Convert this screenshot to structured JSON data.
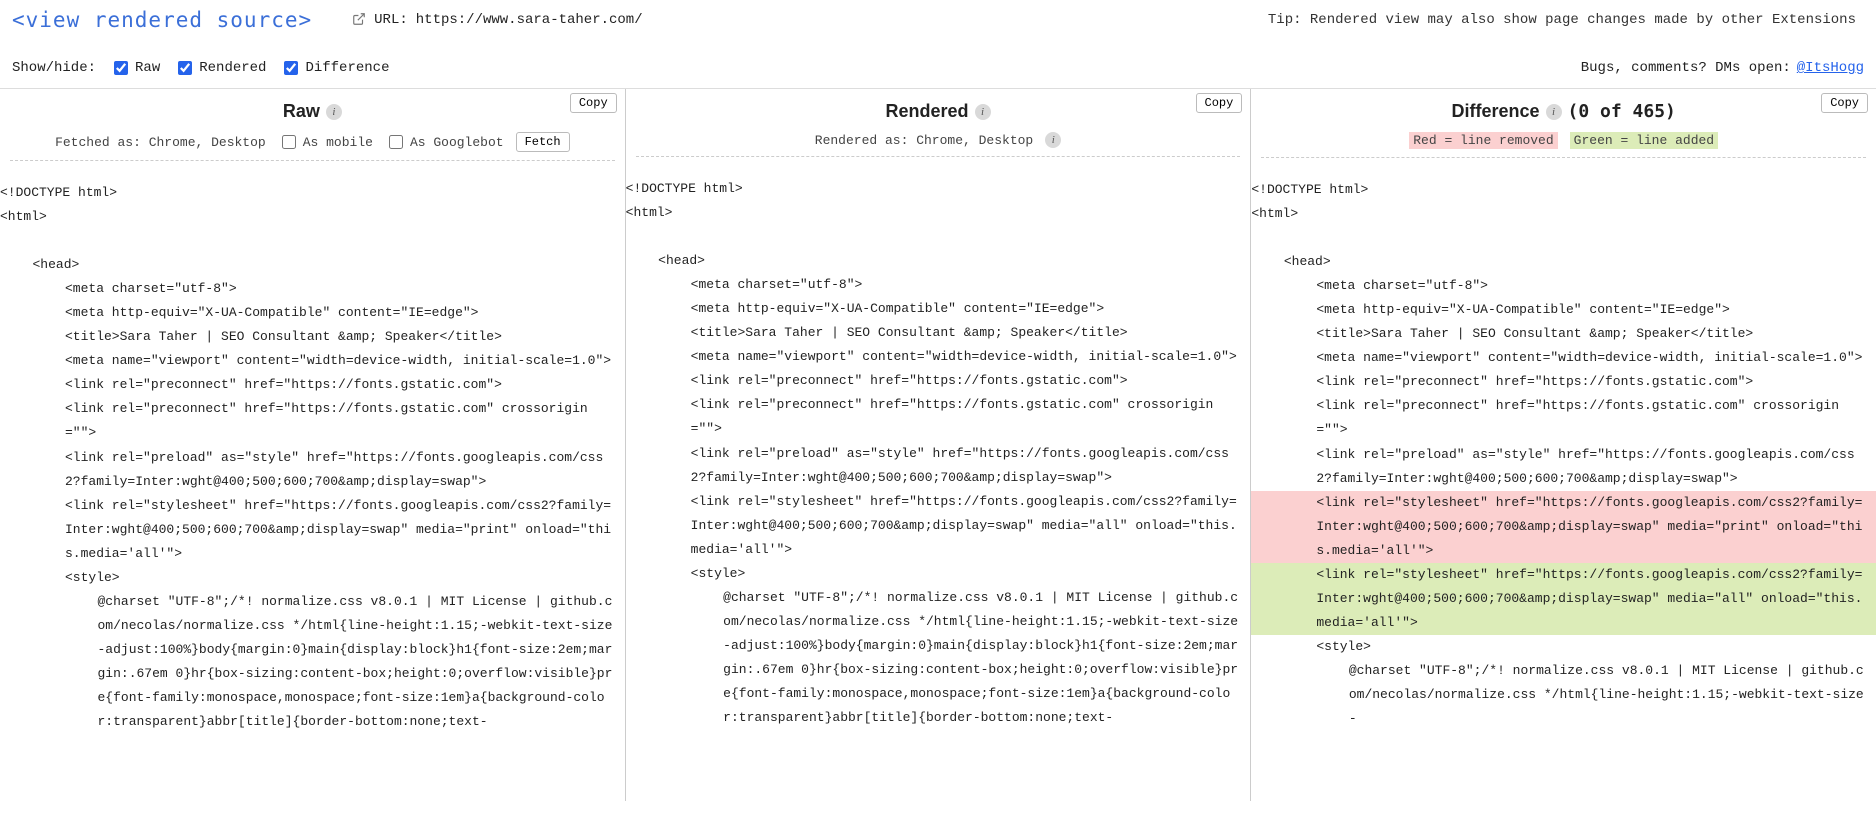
{
  "header": {
    "logo_text": "<view rendered source>",
    "url_label": "URL:",
    "url_value": "https://www.sara-taher.com/",
    "tip_text": "Tip: Rendered view may also show page changes made by other Extensions"
  },
  "controls": {
    "show_hide_label": "Show/hide:",
    "raw_label": "Raw",
    "rendered_label": "Rendered",
    "difference_label": "Difference",
    "bugs_label": "Bugs, comments? DMs open:",
    "bugs_handle": "@ItsHogg"
  },
  "columns": {
    "raw": {
      "title": "Raw",
      "copy_label": "Copy",
      "fetched_as": "Fetched as: Chrome, Desktop",
      "as_mobile": "As mobile",
      "as_googlebot": "As Googlebot",
      "fetch_label": "Fetch"
    },
    "rendered": {
      "title": "Rendered",
      "copy_label": "Copy",
      "rendered_as": "Rendered as: Chrome, Desktop"
    },
    "difference": {
      "title": "Difference",
      "count": "(0 of 465)",
      "copy_label": "Copy",
      "legend_removed": "Red = line removed",
      "legend_added": "Green = line added"
    }
  },
  "source_common": [
    {
      "indent": 0,
      "t": "<!DOCTYPE html>"
    },
    {
      "indent": 0,
      "t": "<html>"
    },
    {
      "indent": 0,
      "t": ""
    },
    {
      "indent": 1,
      "t": "<head>"
    },
    {
      "indent": 2,
      "t": "<meta charset=\"utf-8\">"
    },
    {
      "indent": 2,
      "t": "<meta http-equiv=\"X-UA-Compatible\" content=\"IE=edge\">"
    },
    {
      "indent": 2,
      "t": "<title>Sara Taher | SEO Consultant &amp; Speaker</title>"
    },
    {
      "indent": 2,
      "t": "<meta name=\"viewport\" content=\"width=device-width, initial-scale=1.0\">"
    },
    {
      "indent": 2,
      "t": "<link rel=\"preconnect\" href=\"https://fonts.gstatic.com\">"
    },
    {
      "indent": 2,
      "wrap": true,
      "t": "<link rel=\"preconnect\" href=\"https://fonts.gstatic.com\" crossorigin=\"\">"
    },
    {
      "indent": 2,
      "wrap": true,
      "t": "<link rel=\"preload\" as=\"style\" href=\"https://fonts.googleapis.com/css2?family=Inter:wght@400;500;600;700&amp;display=swap\">"
    }
  ],
  "source_raw_tail": [
    {
      "indent": 2,
      "wrap": true,
      "t": "<link rel=\"stylesheet\" href=\"https://fonts.googleapis.com/css2?family=Inter:wght@400;500;600;700&amp;display=swap\" media=\"print\" onload=\"this.media='all'\">"
    },
    {
      "indent": 2,
      "t": "<style>"
    },
    {
      "indent": 3,
      "wrap": true,
      "t": "@charset \"UTF-8\";/*! normalize.css v8.0.1 | MIT License | github.com/necolas/normalize.css */html{line-height:1.15;-webkit-text-size-adjust:100%}body{margin:0}main{display:block}h1{font-size:2em;margin:.67em 0}hr{box-sizing:content-box;height:0;overflow:visible}pre{font-family:monospace,monospace;font-size:1em}a{background-color:transparent}abbr[title]{border-bottom:none;text-"
    }
  ],
  "source_rendered_tail": [
    {
      "indent": 2,
      "wrap": true,
      "t": "<link rel=\"stylesheet\" href=\"https://fonts.googleapis.com/css2?family=Inter:wght@400;500;600;700&amp;display=swap\" media=\"all\" onload=\"this.media='all'\">"
    },
    {
      "indent": 2,
      "t": "<style>"
    },
    {
      "indent": 3,
      "wrap": true,
      "t": "@charset \"UTF-8\";/*! normalize.css v8.0.1 | MIT License | github.com/necolas/normalize.css */html{line-height:1.15;-webkit-text-size-adjust:100%}body{margin:0}main{display:block}h1{font-size:2em;margin:.67em 0}hr{box-sizing:content-box;height:0;overflow:visible}pre{font-family:monospace,monospace;font-size:1em}a{background-color:transparent}abbr[title]{border-bottom:none;text-"
    }
  ],
  "source_diff_tail": [
    {
      "indent": 2,
      "wrap": true,
      "cls": "diff-removed",
      "t": "<link rel=\"stylesheet\" href=\"https://fonts.googleapis.com/css2?family=Inter:wght@400;500;600;700&amp;display=swap\" media=\"print\" onload=\"this.media='all'\">"
    },
    {
      "indent": 2,
      "wrap": true,
      "cls": "diff-added",
      "t": "<link rel=\"stylesheet\" href=\"https://fonts.googleapis.com/css2?family=Inter:wght@400;500;600;700&amp;display=swap\" media=\"all\" onload=\"this.media='all'\">"
    },
    {
      "indent": 2,
      "t": "<style>"
    },
    {
      "indent": 3,
      "wrap": true,
      "t": "@charset \"UTF-8\";/*! normalize.css v8.0.1 | MIT License | github.com/necolas/normalize.css */html{line-height:1.15;-webkit-text-size-"
    }
  ]
}
